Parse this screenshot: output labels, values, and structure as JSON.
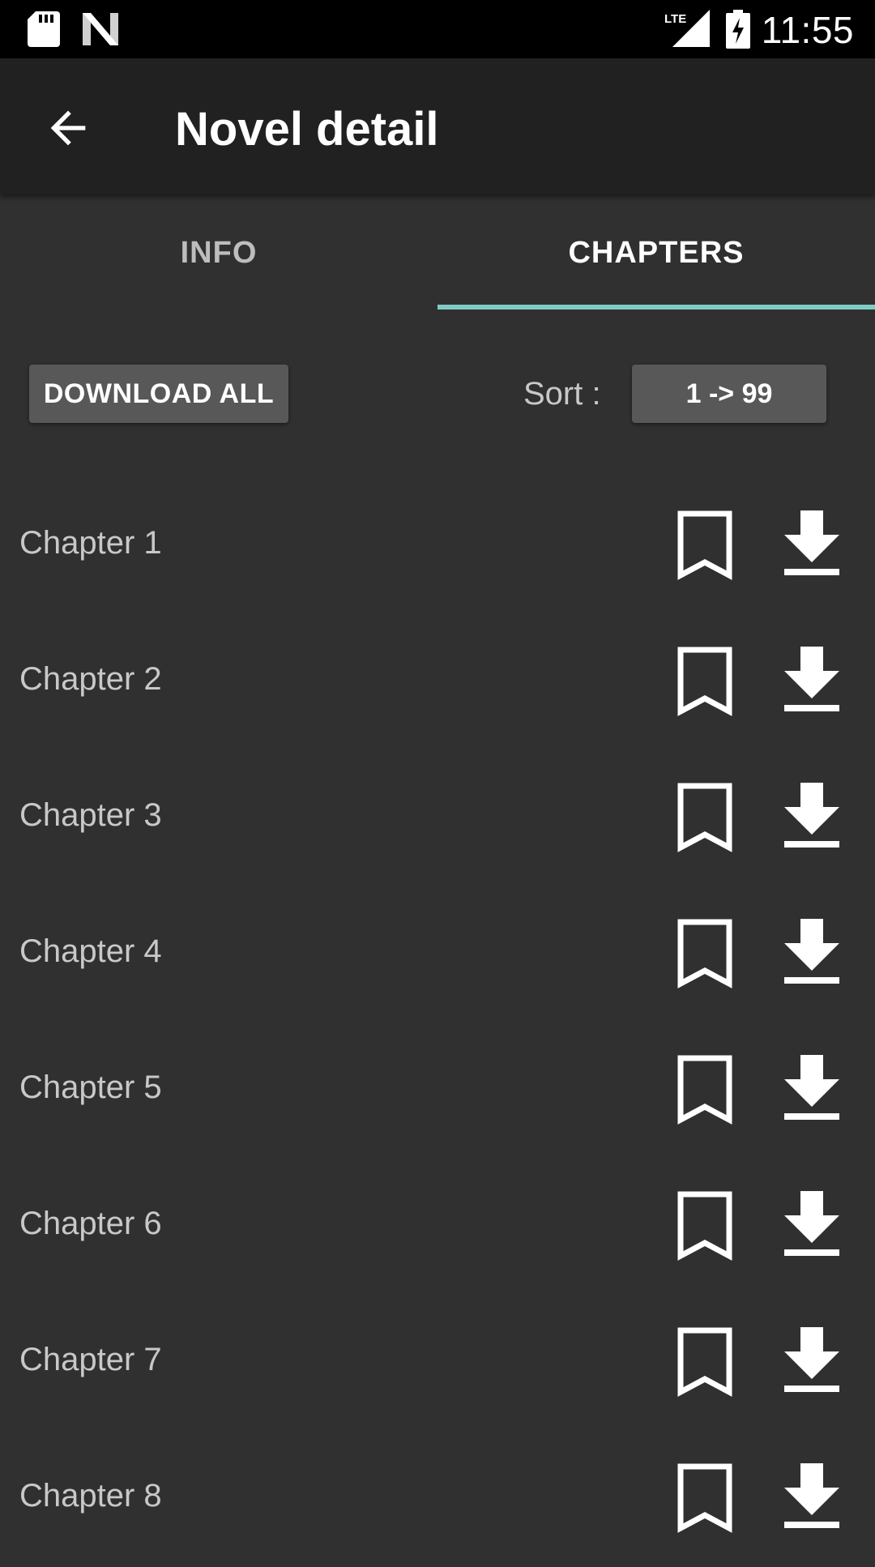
{
  "status_bar": {
    "time": "11:55",
    "icons": [
      "sd-card-icon",
      "n-logo-icon",
      "lte-signal-icon",
      "battery-charging-icon"
    ],
    "lte_label": "LTE"
  },
  "app_bar": {
    "title": "Novel detail",
    "back_icon": "arrow-left-icon"
  },
  "tabs": [
    {
      "label": "INFO",
      "selected": false
    },
    {
      "label": "CHAPTERS",
      "selected": true
    }
  ],
  "controls": {
    "download_all_label": "DOWNLOAD ALL",
    "sort_label": "Sort :",
    "sort_value": "1 -> 99"
  },
  "chapters": [
    {
      "title": "Chapter 1"
    },
    {
      "title": "Chapter 2"
    },
    {
      "title": "Chapter 3"
    },
    {
      "title": "Chapter 4"
    },
    {
      "title": "Chapter 5"
    },
    {
      "title": "Chapter 6"
    },
    {
      "title": "Chapter 7"
    },
    {
      "title": "Chapter 8"
    }
  ],
  "colors": {
    "background": "#303030",
    "app_bar": "#212121",
    "status_bar": "#000000",
    "tab_indicator": "#80cbc4",
    "button": "#585858",
    "secondary_text": "#c8c8c8"
  }
}
